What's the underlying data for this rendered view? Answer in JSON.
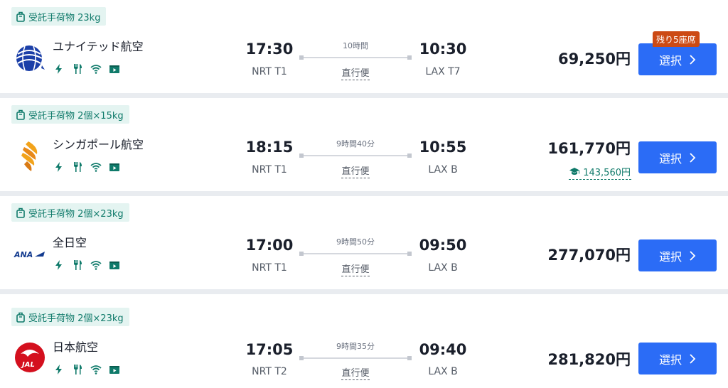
{
  "flights": [
    {
      "baggage": "受託手荷物 23kg",
      "airline": "ユナイテッド航空",
      "logo_icon": "united-globe-icon",
      "amenities": [
        "power-icon",
        "meal-icon",
        "wifi-icon",
        "entertainment-icon"
      ],
      "departure_time": "17:30",
      "departure_airport": "NRT T1",
      "duration": "10時間",
      "stops": "直行便",
      "arrival_time": "10:30",
      "arrival_airport": "LAX T7",
      "price": "69,250円",
      "badge": "残り5座席",
      "select_label": "選択"
    },
    {
      "baggage": "受託手荷物 2個×15kg",
      "airline": "シンガポール航空",
      "logo_icon": "singapore-bird-icon",
      "amenities": [
        "power-icon",
        "meal-icon",
        "wifi-icon",
        "entertainment-icon"
      ],
      "departure_time": "18:15",
      "departure_airport": "NRT T1",
      "duration": "9時間40分",
      "stops": "直行便",
      "arrival_time": "10:55",
      "arrival_airport": "LAX B",
      "price": "161,770円",
      "student_price": "143,560円",
      "select_label": "選択"
    },
    {
      "baggage": "受託手荷物 2個×23kg",
      "airline": "全日空",
      "logo_icon": "ana-logo-icon",
      "logo_text": "ANA",
      "amenities": [
        "power-icon",
        "meal-icon",
        "wifi-icon",
        "entertainment-icon"
      ],
      "departure_time": "17:00",
      "departure_airport": "NRT T1",
      "duration": "9時間50分",
      "stops": "直行便",
      "arrival_time": "09:50",
      "arrival_airport": "LAX B",
      "price": "277,070円",
      "select_label": "選択"
    },
    {
      "baggage": "受託手荷物 2個×23kg",
      "airline": "日本航空",
      "logo_icon": "jal-crane-icon",
      "logo_text": "JAL",
      "amenities": [
        "power-icon",
        "meal-icon",
        "wifi-icon",
        "entertainment-icon"
      ],
      "departure_time": "17:05",
      "departure_airport": "NRT T2",
      "duration": "9時間35分",
      "stops": "直行便",
      "arrival_time": "09:40",
      "arrival_airport": "LAX B",
      "price": "281,820円",
      "select_label": "選択"
    }
  ],
  "colors": {
    "accent": "#2b6cf6",
    "teal": "#0f7a6a",
    "badge": "#cc4a14",
    "baggage_bg": "#e4f4f1"
  }
}
